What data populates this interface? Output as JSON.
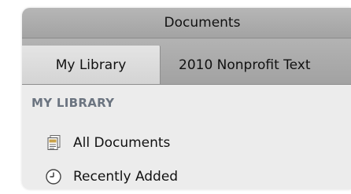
{
  "window": {
    "title": "Documents"
  },
  "tabs": [
    {
      "label": "My Library",
      "active": true
    },
    {
      "label": "2010 Nonprofit Text",
      "active": false
    }
  ],
  "sidebar": {
    "section_header": "MY LIBRARY",
    "items": [
      {
        "label": "All Documents",
        "icon": "documents-icon"
      },
      {
        "label": "Recently Added",
        "icon": "clock-icon"
      }
    ]
  }
}
